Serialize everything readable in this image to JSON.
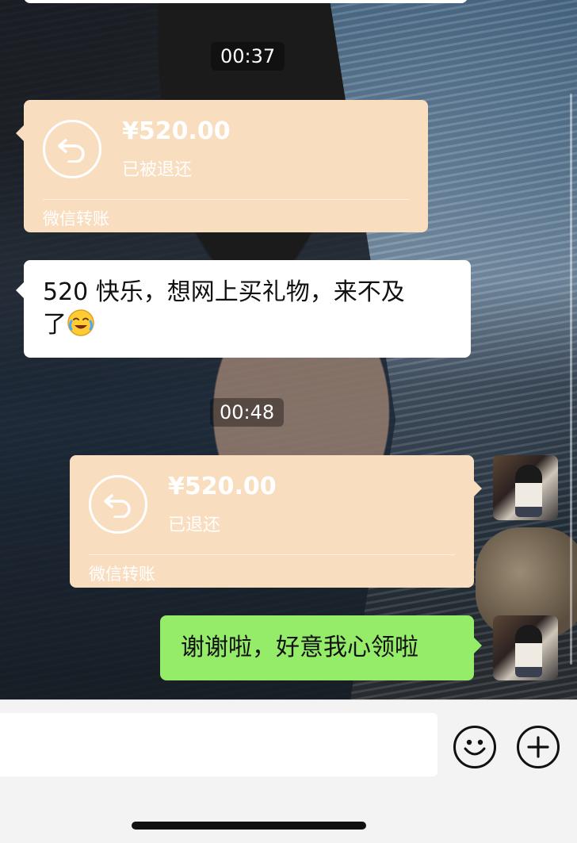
{
  "timestamps": {
    "first": "00:37",
    "second": "00:48"
  },
  "incoming_transfer": {
    "amount": "¥520.00",
    "status": "已被退还",
    "footer": "微信转账"
  },
  "incoming_text": {
    "line1": "520 快乐，想网上买礼物，来不及",
    "line2": "了",
    "emoji": "crying-laughing-face-icon"
  },
  "outgoing_transfer": {
    "amount": "¥520.00",
    "status": "已退还",
    "footer": "微信转账"
  },
  "outgoing_text": {
    "text": "谢谢啦，好意我心领啦"
  },
  "input_bar": {
    "emoji_button": "smiley-face-icon",
    "plus_button": "plus-circle-icon"
  },
  "colors": {
    "transfer_bubble": "#f9ddbf",
    "sent_bubble": "#95ec69",
    "received_bubble": "#ffffff"
  }
}
